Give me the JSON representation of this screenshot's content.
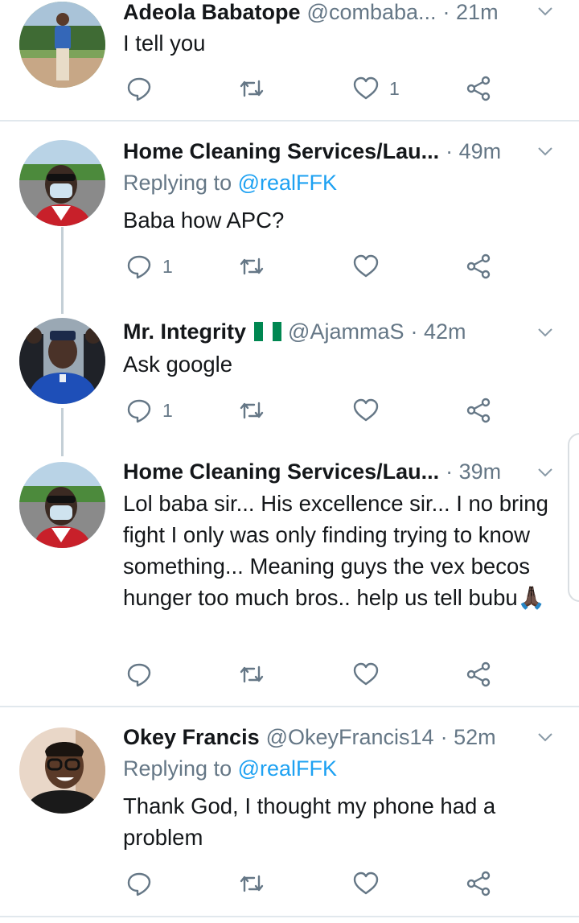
{
  "tweets": [
    {
      "name": "Adeola Babatope",
      "handle": "@combaba...",
      "time": "· 21m",
      "replying_prefix": "",
      "replying_mention": "",
      "text": "I tell you",
      "reply_count": "",
      "like_count": "1"
    },
    {
      "name": "Home Cleaning Services/Lau...",
      "handle": "",
      "time": "· 49m",
      "replying_prefix": "Replying to ",
      "replying_mention": "@realFFK",
      "text": "Baba how APC?",
      "reply_count": "1",
      "like_count": ""
    },
    {
      "name": "Mr. Integrity",
      "handle": "@AjammaS",
      "time": "· 42m",
      "replying_prefix": "",
      "replying_mention": "",
      "text": "Ask google",
      "reply_count": "1",
      "like_count": ""
    },
    {
      "name": "Home Cleaning Services/Lau...",
      "handle": "",
      "time": "· 39m",
      "replying_prefix": "",
      "replying_mention": "",
      "text": "Lol baba sir... His excellence sir... I no bring fight I only was only finding trying to know something... Meaning guys the vex becos hunger too much bros.. help us tell bubu🙏🏿",
      "reply_count": "",
      "like_count": ""
    },
    {
      "name": "Okey Francis",
      "handle": "@OkeyFrancis14",
      "time": "· 52m",
      "replying_prefix": "Replying to ",
      "replying_mention": "@realFFK",
      "text": "Thank God, I thought my phone had a problem",
      "reply_count": "",
      "like_count": ""
    }
  ],
  "colors": {
    "text": "#14171a",
    "secondary": "#657786",
    "accent": "#1da1f2",
    "divider": "#e1e8ed",
    "thread_line": "#c4cfd6"
  },
  "icons": [
    "reply-icon",
    "retweet-icon",
    "like-icon",
    "share-icon",
    "chevron-down-icon",
    "nigeria-flag-icon"
  ]
}
